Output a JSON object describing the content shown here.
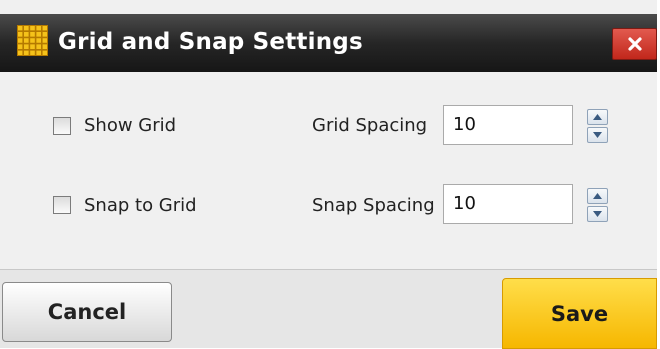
{
  "dialog": {
    "title": "Grid and Snap Settings",
    "title_icon": "grid-icon",
    "close_icon": "close-icon",
    "colors": {
      "titlebar": "#1f1f1f",
      "close": "#c9382d",
      "save": "#f9c415"
    }
  },
  "show_grid": {
    "label": "Show Grid",
    "checked": false
  },
  "snap_to_grid": {
    "label": "Snap to Grid",
    "checked": false
  },
  "grid_spacing": {
    "label": "Grid Spacing",
    "value": "10"
  },
  "snap_spacing": {
    "label": "Snap Spacing",
    "value": "10"
  },
  "footer": {
    "cancel_label": "Cancel",
    "save_label": "Save"
  }
}
